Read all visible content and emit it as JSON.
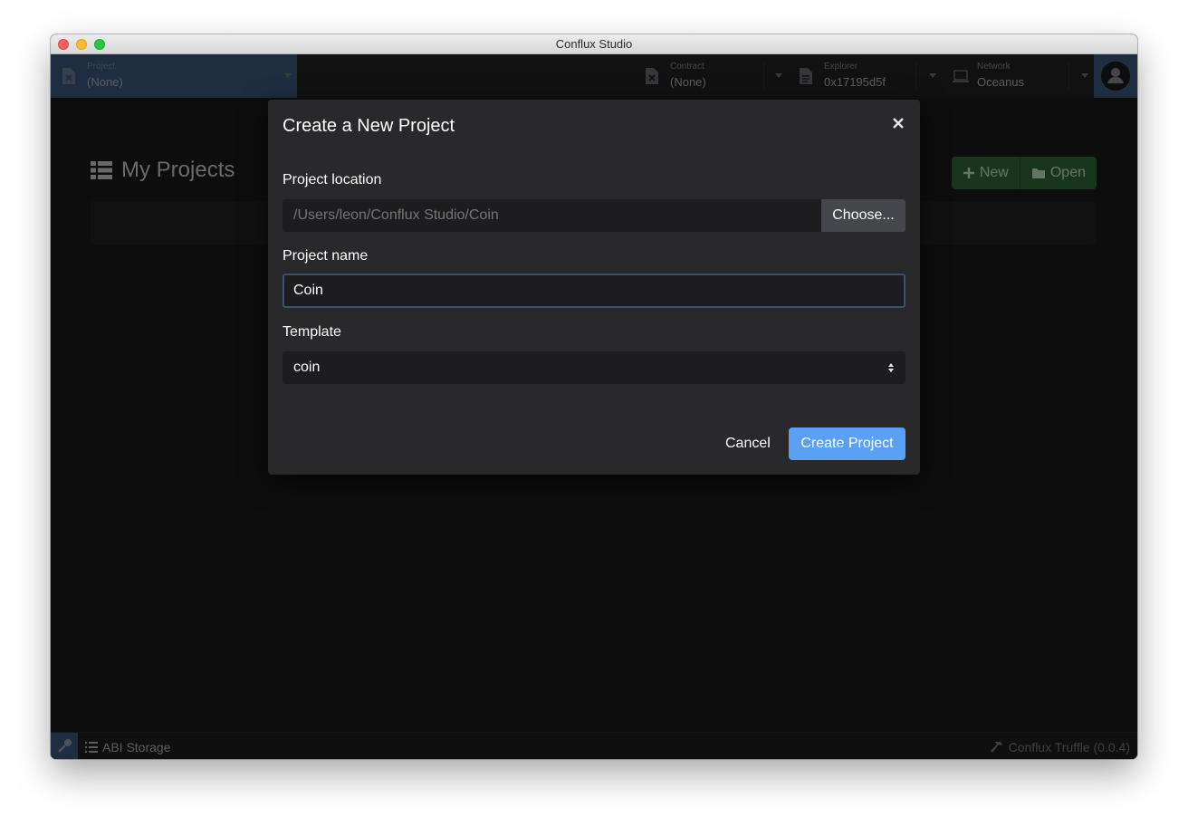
{
  "window": {
    "title": "Conflux Studio"
  },
  "navbar": {
    "project": {
      "label": "Project",
      "value": "(None)"
    },
    "contract": {
      "label": "Contract",
      "value": "(None)"
    },
    "explorer": {
      "label": "Explorer",
      "value": "0x17195d5f"
    },
    "network": {
      "label": "Network",
      "value": "Oceanus"
    }
  },
  "main": {
    "title": "My Projects",
    "new_label": "New",
    "open_label": "Open"
  },
  "statusbar": {
    "abi_label": "ABI Storage",
    "truffle_label": "Conflux Truffle (0.0.4)"
  },
  "modal": {
    "title": "Create a New Project",
    "location_label": "Project location",
    "location_placeholder": "/Users/leon/Conflux Studio/Coin",
    "choose_label": "Choose...",
    "name_label": "Project name",
    "name_value": "Coin",
    "template_label": "Template",
    "template_value": "coin",
    "cancel_label": "Cancel",
    "create_label": "Create Project"
  },
  "colors": {
    "accent": "#5aa1f5",
    "nav_active": "#3d5a80",
    "green": "#2f6c3a"
  }
}
